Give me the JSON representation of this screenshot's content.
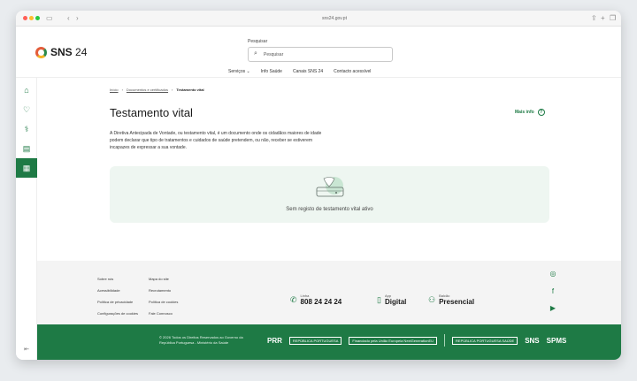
{
  "browser": {
    "url": "sns24.gov.pt",
    "nav_icons": [
      "sidebar-toggle-icon",
      "back-icon",
      "forward-icon"
    ]
  },
  "header": {
    "logo_text": "SNS",
    "logo_number": "24",
    "search_label": "Pesquisar",
    "search_placeholder": "Pesquisar",
    "nav": [
      {
        "label": "Serviços ⌄"
      },
      {
        "label": "Info Saúde"
      },
      {
        "label": "Canais SNS 24"
      },
      {
        "label": "Contacto acessível"
      }
    ]
  },
  "sidebar": {
    "items": [
      {
        "icon": "home-icon",
        "glyph": "⌂"
      },
      {
        "icon": "health-icon",
        "glyph": "♡"
      },
      {
        "icon": "medication-icon",
        "glyph": "⚕"
      },
      {
        "icon": "clipboard-icon",
        "glyph": "▤"
      },
      {
        "icon": "document-icon",
        "glyph": "▦"
      }
    ],
    "active_index": 4,
    "collapse_glyph": "⇤"
  },
  "breadcrumb": {
    "items": [
      "Início",
      "Documentos e certificados"
    ],
    "current": "Testamento vital"
  },
  "page": {
    "title": "Testamento vital",
    "more_info": "Mais info",
    "description": "A Diretiva Antecipada de Vontade, ou testamento vital, é um documento onde os cidadãos maiores de idade podem declarar que tipo de tratamentos e cuidados de saúde pretendem, ou não, receber se estiverem incapazes de expressar a sua vontade.",
    "empty_message": "Sem registo de testamento vital ativo"
  },
  "footer": {
    "links_col1": [
      "Sobre nós",
      "Acessibilidade",
      "Política de privacidade",
      "Configurações de cookies"
    ],
    "links_col2": [
      "Mapa do site",
      "Recrutamento",
      "Política de cookies",
      "Fale Connosco"
    ],
    "contacts": [
      {
        "small": "Linha",
        "big": "808 24 24 24",
        "icon": "phone-icon",
        "glyph": "✆"
      },
      {
        "small": "App",
        "big": "Digital",
        "icon": "mobile-icon",
        "glyph": "▯"
      },
      {
        "small": "Balcão",
        "big": "Presencial",
        "icon": "people-icon",
        "glyph": "⚇"
      }
    ],
    "social": [
      {
        "icon": "instagram-icon",
        "glyph": "◎"
      },
      {
        "icon": "facebook-icon",
        "glyph": "f"
      },
      {
        "icon": "youtube-icon",
        "glyph": "▶"
      }
    ],
    "copyright": "© 2026 Todos os Direitos Reservados ao Governo da República Portuguesa - Ministério da Saúde",
    "partners": {
      "prr": "PRR",
      "republica": "REPÚBLICA PORTUGUESA",
      "eu": "Financiado pela União Europeia NextGenerationEU",
      "saude": "REPÚBLICA PORTUGUESA SAÚDE",
      "sns": "SNS",
      "spms": "SPMS"
    }
  },
  "colors": {
    "brand_green": "#1e7a45",
    "panel_bg": "#eef6f1"
  }
}
